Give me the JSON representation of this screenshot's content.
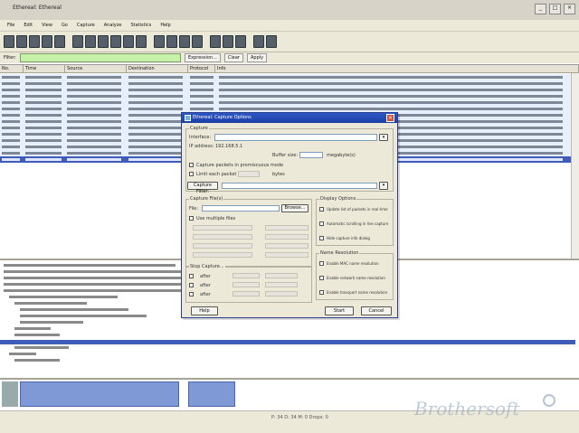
{
  "window": {
    "title": "Ethereal: Ethereal",
    "controls": [
      "_",
      "□",
      "×"
    ]
  },
  "menu": [
    "File",
    "Edit",
    "View",
    "Go",
    "Capture",
    "Analyze",
    "Statistics",
    "Help"
  ],
  "toolbar_icons": [
    "open-icon",
    "save-icon",
    "close-icon",
    "reload-icon",
    "print-icon",
    "find-icon",
    "back-icon",
    "forward-icon",
    "goto-icon",
    "first-icon",
    "last-icon",
    "zoom-in-icon",
    "zoom-out-icon",
    "zoom-normal-icon",
    "resize-icon",
    "capture-options-icon",
    "capture-start-icon",
    "capture-stop-icon",
    "preferences-icon",
    "help-icon"
  ],
  "filter": {
    "label": "Filter:",
    "expression": "",
    "buttons": [
      "Expression...",
      "Clear",
      "Apply"
    ]
  },
  "packet_list": {
    "columns": [
      "No.",
      "Time",
      "Source",
      "Destination",
      "Protocol",
      "Info"
    ]
  },
  "dialog": {
    "title": "Ethereal: Capture Options",
    "close": "×",
    "capture_label": "Capture",
    "interface_label": "Interface:",
    "interface_value": "",
    "ip_address": "IP address: 192.168.5.1",
    "link_layer_label": "Buffer size:",
    "units": "megabyte(s)",
    "promiscuous": "Capture packets in promiscuous mode",
    "limit_each": "Limit each packet to",
    "bytes": "bytes",
    "capture_filter_btn": "Capture Filter:",
    "capture_file_group": "Capture File(s)",
    "file_label": "File:",
    "browse_btn": "Browse...",
    "multiple_files": "Use multiple files",
    "stop_group": "Stop Capture...",
    "stop_rows": [
      "after",
      "after",
      "after"
    ],
    "display_group": "Display Options",
    "display_opts": [
      "Update list of packets in real time",
      "Automatic scrolling in live capture",
      "Hide capture info dialog"
    ],
    "name_group": "Name Resolution",
    "name_opts": [
      "Enable MAC name resolution",
      "Enable network name resolution",
      "Enable transport name resolution"
    ],
    "help_btn": "Help",
    "start_btn": "Start",
    "cancel_btn": "Cancel"
  },
  "status": "P: 34 D: 34 M: 0 Drops: 0",
  "watermark": "Brothersoft"
}
